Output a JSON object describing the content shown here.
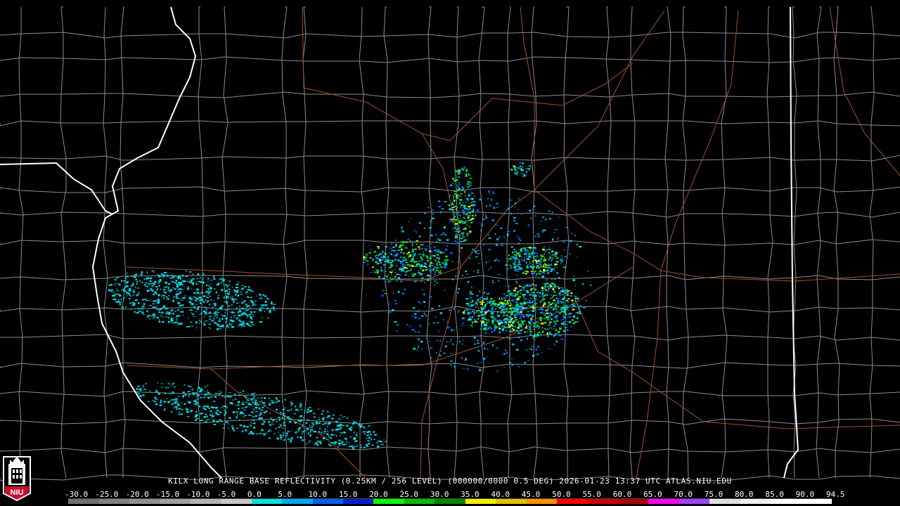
{
  "title": "KILX LONG RANGE BASE REFLECTIVITY (0.25KM / 256 LEVEL) (000000/0000 0.5 DEG) 2026-01-23 13:37 UTC  ATLAS.NIU.EDU",
  "logo": {
    "text": "NIU",
    "icon": "university-tower-icon",
    "color": "#c8102e"
  },
  "scale": {
    "labels": [
      "-30.0",
      "-25.0",
      "-20.0",
      "-15.0",
      "-10.0",
      "-5.0",
      "0.0",
      "5.0",
      "10.0",
      "15.0",
      "20.0",
      "25.0",
      "30.0",
      "35.0",
      "40.0",
      "45.0",
      "50.0",
      "55.0",
      "60.0",
      "65.0",
      "70.0",
      "75.0",
      "80.0",
      "85.0",
      "90.0",
      "94.5"
    ],
    "colors": [
      "#707070",
      "#808080",
      "#909090",
      "#a0a0a0",
      "#b4b4b4",
      "#c8c8c8",
      "#00e0e0",
      "#00a8f0",
      "#0060f0",
      "#0020c8",
      "#00ff00",
      "#00c000",
      "#008800",
      "#f0f000",
      "#e0c000",
      "#ff9000",
      "#ff0000",
      "#d00000",
      "#b00000",
      "#ff00ff",
      "#a040ff",
      "#e0e0e0",
      "#f0f0f0",
      "#ffffff",
      "#ffffff"
    ]
  },
  "map_colors": {
    "background": "#000000",
    "county_lines": "#8c8c8c",
    "state_lines": "#ffffff",
    "highways": "#a0522d"
  }
}
